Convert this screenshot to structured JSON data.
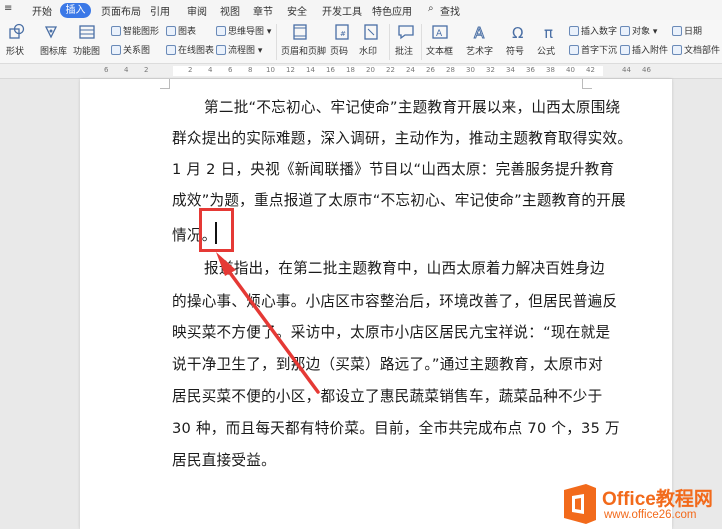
{
  "menu": {
    "items": [
      "开始",
      "插入",
      "页面布局",
      "引用",
      "审阅",
      "视图",
      "章节",
      "安全",
      "开发工具",
      "特色应用"
    ],
    "search_label": "查找",
    "active_tab": "插入"
  },
  "ribbon": {
    "shape": "形状",
    "icon_lib": "图标库",
    "func_chart": "功能图",
    "smart_art": "智能图形",
    "chart": "图表",
    "mind_map": "思维导图",
    "relation_map": "关系图",
    "online_chart": "在线图表",
    "flow_chart": "流程图",
    "header_footer": "页眉和页脚",
    "page_number": "页码",
    "watermark": "水印",
    "comment": "批注",
    "text_box": "文本框",
    "art_text": "艺术字",
    "symbol": "符号",
    "formula": "公式",
    "insert_number": "插入数字",
    "object": "对象",
    "date": "日期",
    "drop_cap": "首字下沉",
    "attachment": "插入附件",
    "doc_parts": "文档部件"
  },
  "ruler": {
    "ticks": [
      "6",
      "4",
      "2",
      "2",
      "4",
      "6",
      "8",
      "10",
      "12",
      "14",
      "16",
      "18",
      "20",
      "22",
      "24",
      "26",
      "28",
      "30",
      "32",
      "34",
      "36",
      "38",
      "40",
      "42",
      "44",
      "46"
    ]
  },
  "document": {
    "lines": [
      "第二批“不忘初心、牢记使命”主题教育开展以来，山西太原围绕",
      "群众提出的实际难题，深入调研，主动作为，推动主题教育取得实效。",
      "1 月 2 日，央视《新闻联播》节目以“山西太原：完善服务提升教育",
      "成效”为题，重点报道了太原市“不忘初心、牢记使命”主题教育的开展",
      "情况。",
      "报道指出，在第二批主题教育中，山西太原着力解决百姓身边",
      "的操心事、烦心事。小店区市容整治后，环境改善了，但居民普遍反",
      "映买菜不方便了。采访中，太原市小店区居民亢宝祥说：“现在就是",
      "说干净卫生了，到那边（买菜）路远了。”通过主题教育，太原市对",
      "居民买菜不便的小区，都设立了惠民蔬菜销售车，蔬菜品种不少于",
      "30 种，而且每天都有特价菜。目前，全市共完成布点 70 个，35 万",
      "居民直接受益。"
    ]
  },
  "watermark": {
    "brand": "Office教程网",
    "url": "www.office26.com"
  },
  "colors": {
    "accent": "#3a78e7",
    "annotation": "#e53935",
    "watermark_orange": "#f26a1b"
  }
}
